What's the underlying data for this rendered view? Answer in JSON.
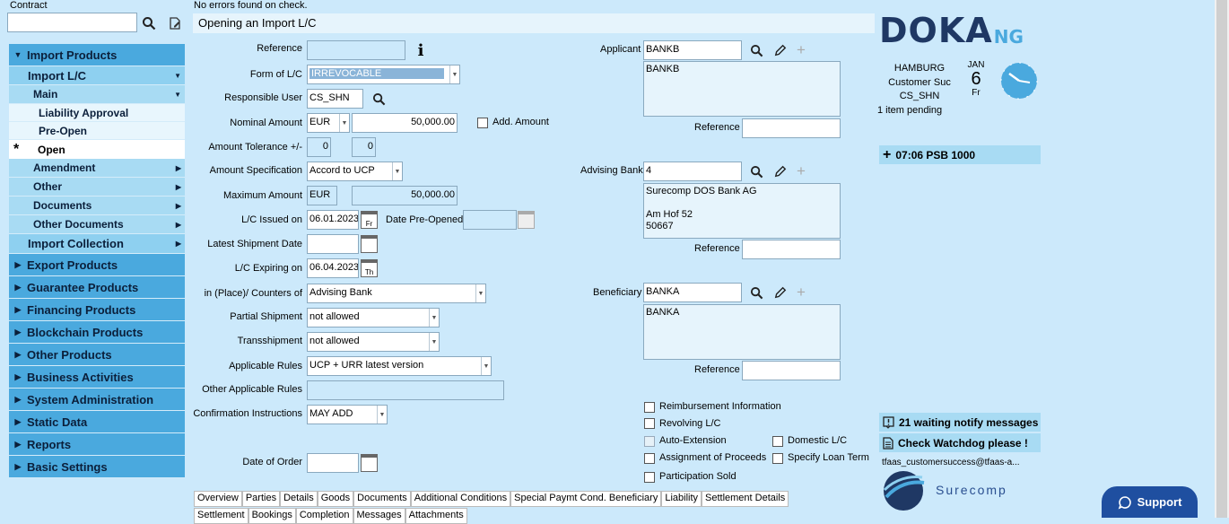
{
  "contract": {
    "label": "Contract",
    "value": ""
  },
  "nav": {
    "import_products": "Import Products",
    "import_lc": "Import L/C",
    "main": "Main",
    "liability_approval": "Liability Approval",
    "pre_open": "Pre-Open",
    "open": "Open",
    "amendment": "Amendment",
    "other": "Other",
    "documents": "Documents",
    "other_documents": "Other Documents",
    "import_collection": "Import Collection",
    "sections": [
      "Export Products",
      "Guarantee Products",
      "Financing Products",
      "Blockchain Products",
      "Other Products",
      "Business Activities",
      "System Administration",
      "Static Data",
      "Reports",
      "Basic Settings"
    ]
  },
  "status": "No errors found on check.",
  "title": "Opening an Import L/C",
  "form": {
    "reference_label": "Reference",
    "reference": "",
    "form_lc_label": "Form of L/C",
    "form_lc": "IRREVOCABLE",
    "resp_user_label": "Responsible User",
    "resp_user": "CS_SHN",
    "nominal_label": "Nominal Amount",
    "nominal_ccy": "EUR",
    "nominal_amt": "50,000.00",
    "add_amount_label": "Add. Amount",
    "tolerance_label": "Amount Tolerance +/-",
    "tol_plus": "0",
    "tol_minus": "0",
    "amount_spec_label": "Amount Specification",
    "amount_spec": "Accord to UCP",
    "max_amount_label": "Maximum Amount",
    "max_ccy": "EUR",
    "max_amt": "50,000.00",
    "issued_label": "L/C Issued on",
    "issued": "06.01.2023",
    "issued_day": "Fr",
    "preopened_label": "Date Pre-Opened",
    "preopened": "",
    "latest_ship_label": "Latest Shipment Date",
    "latest_ship": "",
    "expiring_label": "L/C Expiring on",
    "expiring": "06.04.2023",
    "expiring_day": "Th",
    "place_label": "in (Place)/ Counters of",
    "place": "Advising Bank",
    "partial_label": "Partial Shipment",
    "partial": "not allowed",
    "trans_label": "Transshipment",
    "trans": "not allowed",
    "rules_label": "Applicable Rules",
    "rules": "UCP + URR latest version",
    "other_rules_label": "Other Applicable Rules",
    "other_rules": "",
    "confirm_label": "Confirmation Instructions",
    "confirm": "MAY ADD",
    "order_date_label": "Date of Order",
    "order_date": ""
  },
  "parties": {
    "applicant_label": "Applicant",
    "applicant": "BANKB",
    "applicant_addr": "BANKB",
    "advising_label": "Advising Bank",
    "advising": "4",
    "advising_addr": "Surecomp DOS Bank AG\n\nAm Hof 52\n50667",
    "beneficiary_label": "Beneficiary",
    "beneficiary": "BANKA",
    "beneficiary_addr": "BANKA",
    "reference_label": "Reference"
  },
  "checks": {
    "reimb": "Reimbursement Information",
    "revolving": "Revolving L/C",
    "auto_ext": "Auto-Extension",
    "domestic": "Domestic L/C",
    "assignment": "Assignment of Proceeds",
    "loan_term": "Specify Loan Term",
    "participation": "Participation Sold"
  },
  "tabs_row1": [
    "Overview",
    "Parties",
    "Details",
    "Goods",
    "Documents",
    "Additional Conditions",
    "Special Paymt Cond. Beneficiary",
    "Liability",
    "Settlement Details"
  ],
  "tabs_row2": [
    "Settlement",
    "Bookings",
    "Completion",
    "Messages",
    "Attachments"
  ],
  "brand": {
    "logo_main": "DOKA",
    "logo_suffix": "NG",
    "footer_logo": "Surecomp"
  },
  "session": {
    "location": "HAMBURG",
    "user_org": "Customer Suc",
    "user": "CS_SHN",
    "pending": "1 item pending",
    "month": "JAN",
    "day": "6",
    "weekday": "Fr"
  },
  "alerts": {
    "time_entry": "07:06 PSB 1000",
    "notify": "21 waiting notify messages",
    "watchdog": "Check Watchdog please !",
    "email": "tfaas_customersuccess@tfaas-a..."
  },
  "support": "Support",
  "colors": {
    "bg": "#cce9fb",
    "nav_header": "#4aa9de",
    "brand_dark": "#1f3864",
    "brand_accent": "#4aa9de"
  }
}
